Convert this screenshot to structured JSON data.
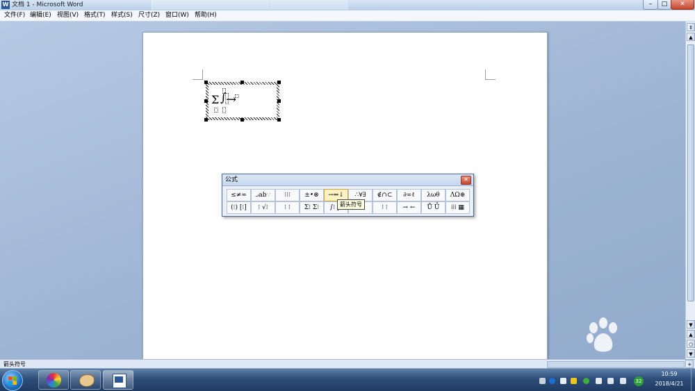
{
  "window": {
    "title": "文档 1 - Microsoft Word",
    "app_icon": "W",
    "controls": {
      "minimize": "–",
      "maximize": "□",
      "close": "✕"
    }
  },
  "menu": [
    "文件(F)",
    "编辑(E)",
    "视图(V)",
    "格式(T)",
    "样式(S)",
    "尺寸(Z)",
    "窗口(W)",
    "帮助(H)"
  ],
  "equation": {
    "symbols": [
      "Σ",
      "∫",
      "→"
    ]
  },
  "formula_palette": {
    "title": "公式",
    "close": "✕",
    "row1": [
      "≤≠≈",
      "⨼ab∵",
      "⁝⁝⁝",
      "±•⊗",
      "→⇔↓",
      "∴∀∃",
      "∉∩⊂",
      "∂∞ℓ",
      "λωθ",
      "ΛΩ⊛"
    ],
    "row2": [
      "(⁝) [⁝]",
      "⁝ √⁝",
      "⁝ ⁝",
      "Σ⁝ Σ⁝",
      "∫⁝ ∮⁝",
      "⁝ ⁝",
      "⁝ ⁝",
      "→ ←",
      "Ů Ṻ",
      "⁞⁞⁞ ▦"
    ],
    "tooltip": "箭头符号"
  },
  "status": {
    "text": "箭头符号"
  },
  "taskbar": {
    "tray_badge": "32",
    "time": "10:59",
    "date": "2018/4/21"
  },
  "colors": {
    "title_bar": "#c7d8ee",
    "close_red": "#c4462c",
    "taskbar": "#2d4e79"
  }
}
